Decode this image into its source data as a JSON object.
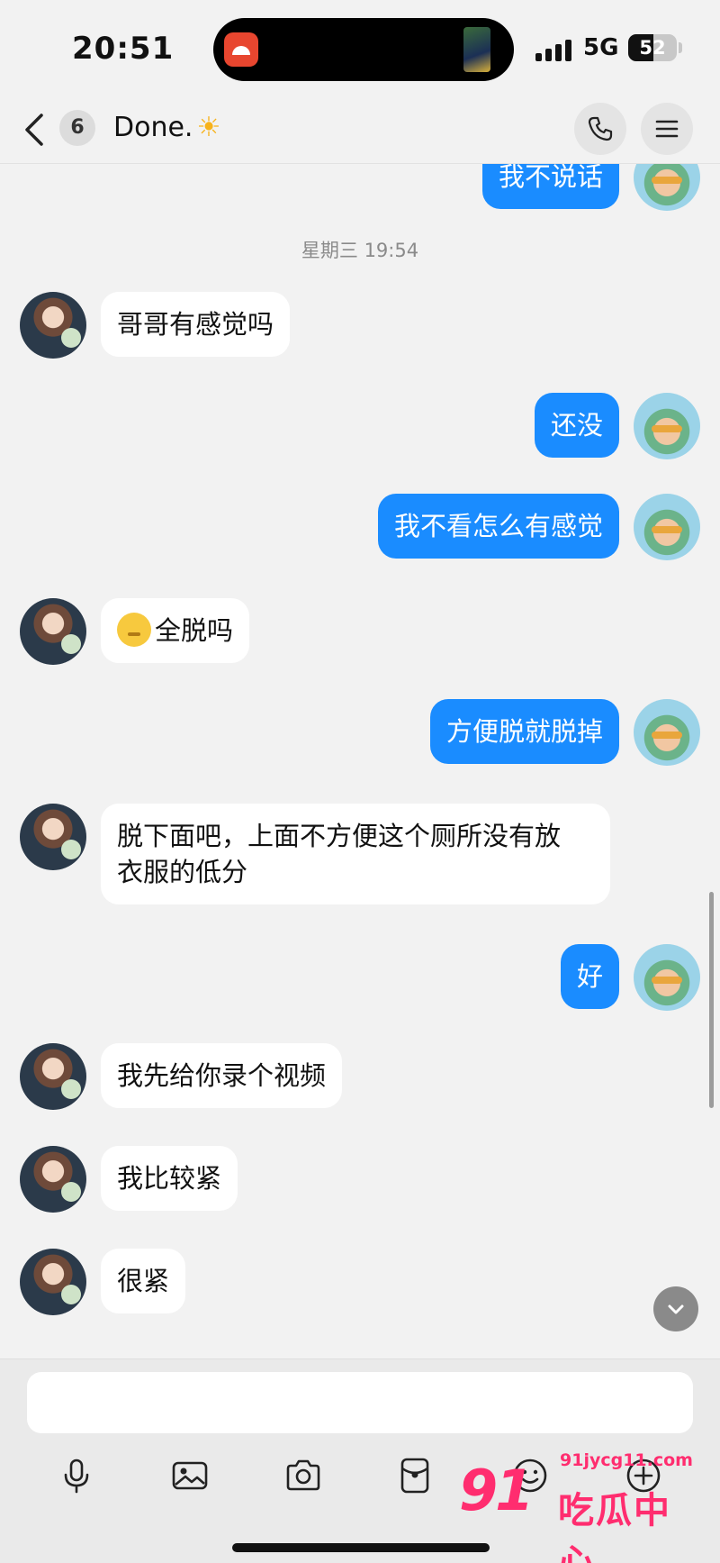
{
  "status_bar": {
    "time": "20:51",
    "network": "5G",
    "battery_level": "52",
    "battery_fraction": 0.52,
    "signal_bars": 4
  },
  "header": {
    "back_icon": "chevron-left-icon",
    "unread_count": "6",
    "contact_name": "Done.",
    "contact_emoji": "☀",
    "call_icon": "phone-icon",
    "menu_icon": "menu-icon"
  },
  "chat": {
    "timestamp": "星期三 19:54",
    "messages": [
      {
        "side": "out",
        "text": "我不说话"
      },
      {
        "side": "in",
        "text": "哥哥有感觉吗"
      },
      {
        "side": "out",
        "text": "还没"
      },
      {
        "side": "out",
        "text": "我不看怎么有感觉"
      },
      {
        "side": "in",
        "text": "全脱吗",
        "emoji": "shushing-face-emoji"
      },
      {
        "side": "out",
        "text": "方便脱就脱掉"
      },
      {
        "side": "in",
        "text_line1": "脱下面吧，上面不方便这个厕所没有放",
        "text_line2": "衣服的低分"
      },
      {
        "side": "out",
        "text": "好"
      },
      {
        "side": "in",
        "text": "我先给你录个视频"
      },
      {
        "side": "in",
        "text": "我比较紧"
      },
      {
        "side": "in",
        "text": "很紧"
      }
    ]
  },
  "composer": {
    "input_value": "",
    "tools": [
      "microphone-icon",
      "image-icon",
      "camera-icon",
      "red-packet-icon",
      "emoji-icon",
      "add-icon"
    ]
  },
  "watermark": {
    "logo": "91",
    "url": "91jycg11.com",
    "name": "吃瓜中心"
  },
  "colors": {
    "outgoing_bubble": "#1a8cff",
    "incoming_bubble": "#ffffff",
    "background": "#f2f2f2",
    "watermark": "#ff2d6f"
  }
}
